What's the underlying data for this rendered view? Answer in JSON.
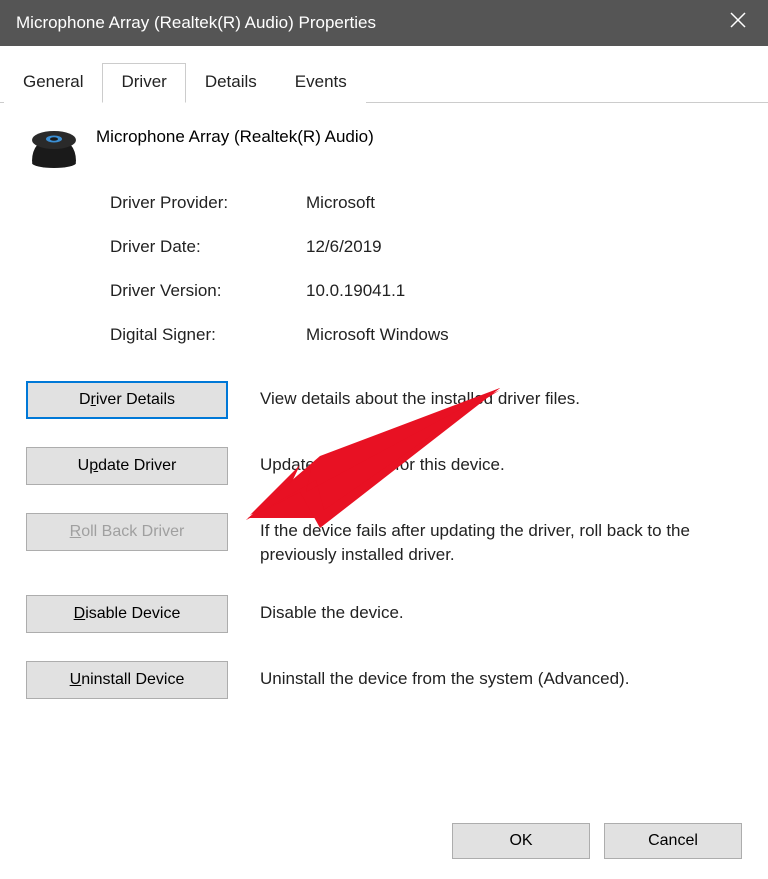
{
  "window": {
    "title": "Microphone Array (Realtek(R) Audio) Properties"
  },
  "tabs": [
    {
      "label": "General"
    },
    {
      "label": "Driver"
    },
    {
      "label": "Details"
    },
    {
      "label": "Events"
    }
  ],
  "device": {
    "name": "Microphone Array (Realtek(R) Audio)"
  },
  "info": {
    "provider_label": "Driver Provider:",
    "provider_value": "Microsoft",
    "date_label": "Driver Date:",
    "date_value": "12/6/2019",
    "version_label": "Driver Version:",
    "version_value": "10.0.19041.1",
    "signer_label": "Digital Signer:",
    "signer_value": "Microsoft Windows"
  },
  "buttons": {
    "details": {
      "pre": "D",
      "accel": "r",
      "post": "iver Details",
      "desc": "View details about the installed driver files."
    },
    "update": {
      "pre": "U",
      "accel": "p",
      "post": "date Driver",
      "desc": "Update the driver for this device."
    },
    "rollback": {
      "pre": "",
      "accel": "R",
      "post": "oll Back Driver",
      "desc": "If the device fails after updating the driver, roll back to the previously installed driver."
    },
    "disable": {
      "pre": "",
      "accel": "D",
      "post": "isable Device",
      "desc": "Disable the device."
    },
    "uninstall": {
      "pre": "",
      "accel": "U",
      "post": "ninstall Device",
      "desc": "Uninstall the device from the system (Advanced)."
    }
  },
  "dialog_buttons": {
    "ok": "OK",
    "cancel": "Cancel"
  }
}
